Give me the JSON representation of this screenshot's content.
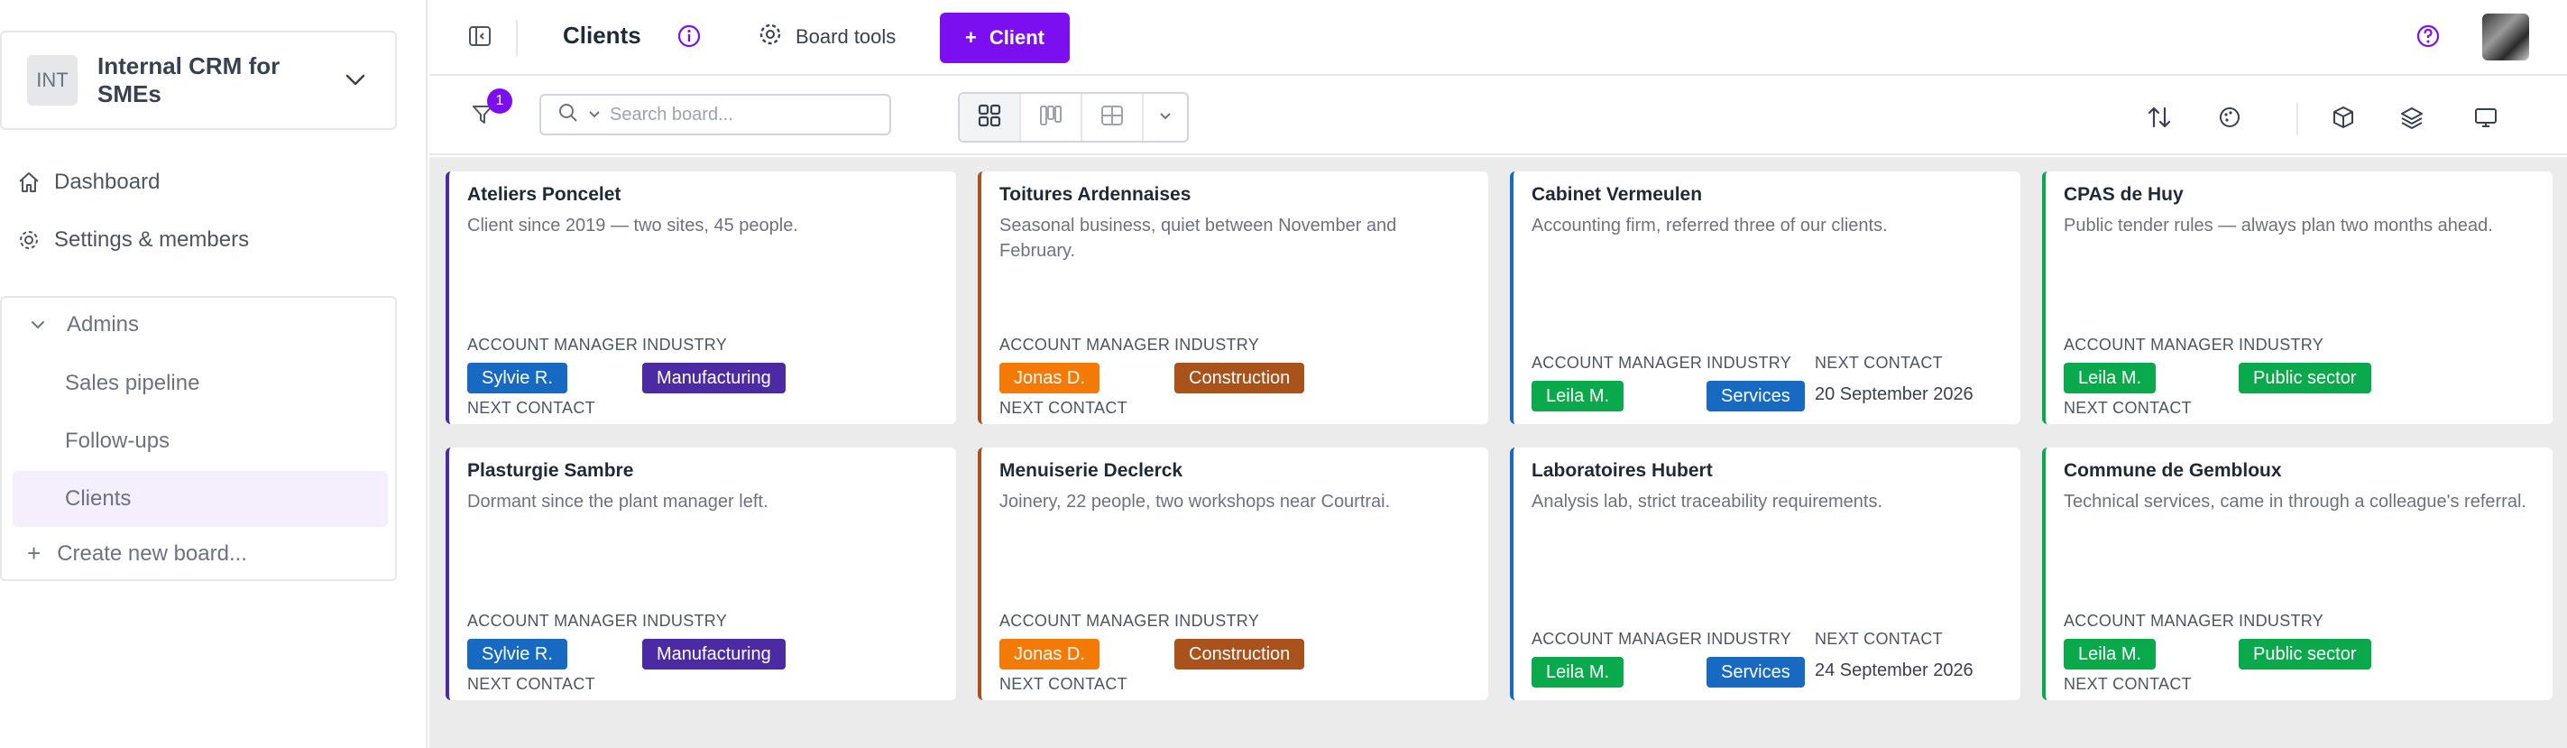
{
  "workspace": {
    "initials": "INT",
    "name": "Internal CRM for SMEs"
  },
  "nav": {
    "dashboard": "Dashboard",
    "settings": "Settings & members"
  },
  "boards": {
    "group_label": "Admins",
    "items": [
      "Sales pipeline",
      "Follow-ups",
      "Clients"
    ],
    "active": "Clients",
    "create_label": "Create new board..."
  },
  "topbar": {
    "title": "Clients",
    "board_tools": "Board tools",
    "new_button": "Client"
  },
  "toolbar": {
    "filter_count": "1",
    "search_placeholder": "Search board..."
  },
  "field_labels": {
    "account_manager": "ACCOUNT MANAGER",
    "industry": "INDUSTRY",
    "next_contact": "NEXT CONTACT"
  },
  "colors": {
    "accent": "#7c0ff0",
    "manager_sylvie": "#1769c2",
    "manager_jonas": "#f47a07",
    "manager_leila": "#0aaa4c",
    "ind_manufacturing": "#4b2aa3",
    "ind_construction": "#a9521b",
    "ind_services": "#1769c2",
    "ind_public": "#0aaa4c",
    "border_purple": "#4b2aa3",
    "border_brown": "#a9521b",
    "border_blue": "#1769c2",
    "border_green": "#0aaa4c"
  },
  "cards": [
    {
      "title": "Ateliers Poncelet",
      "desc": "Client since 2019 — two sites, 45 people.",
      "manager": "Sylvie R.",
      "industry": "Manufacturing",
      "next_contact": ""
    },
    {
      "title": "Toitures Ardennaises",
      "desc": "Seasonal business, quiet between November and February.",
      "manager": "Jonas D.",
      "industry": "Construction",
      "next_contact": ""
    },
    {
      "title": "Cabinet Vermeulen",
      "desc": "Accounting firm, referred three of our clients.",
      "manager": "Leila M.",
      "industry": "Services",
      "next_contact": "20 September 2026"
    },
    {
      "title": "CPAS de Huy",
      "desc": "Public tender rules — always plan two months ahead.",
      "manager": "Leila M.",
      "industry": "Public sector",
      "next_contact": ""
    },
    {
      "title": "Plasturgie Sambre",
      "desc": "Dormant since the plant manager left.",
      "manager": "Sylvie R.",
      "industry": "Manufacturing",
      "next_contact": ""
    },
    {
      "title": "Menuiserie Declerck",
      "desc": "Joinery, 22 people, two workshops near Courtrai.",
      "manager": "Jonas D.",
      "industry": "Construction",
      "next_contact": ""
    },
    {
      "title": "Laboratoires Hubert",
      "desc": "Analysis lab, strict traceability requirements.",
      "manager": "Leila M.",
      "industry": "Services",
      "next_contact": "24 September 2026"
    },
    {
      "title": "Commune de Gembloux",
      "desc": "Technical services, came in through a colleague's referral.",
      "manager": "Leila M.",
      "industry": "Public sector",
      "next_contact": ""
    }
  ]
}
